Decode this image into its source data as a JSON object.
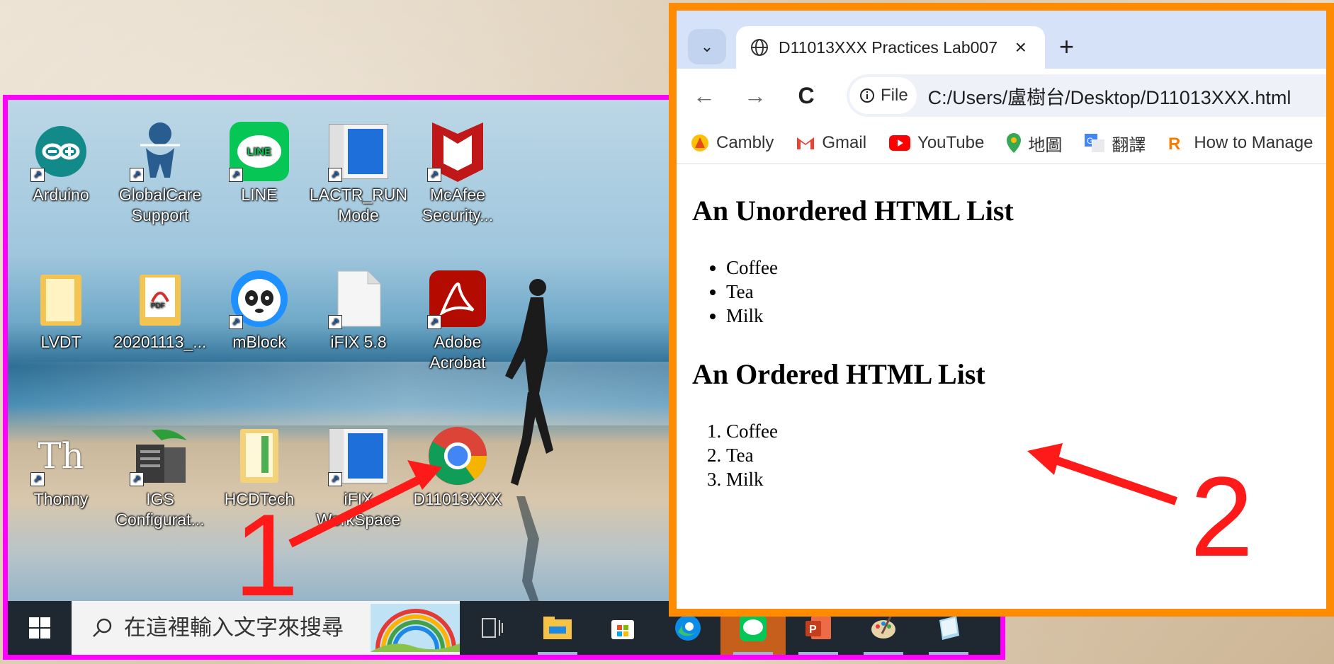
{
  "desktop": {
    "icons": [
      {
        "label_line1": "Arduino",
        "label_line2": ""
      },
      {
        "label_line1": "GlobalCare",
        "label_line2": "Support"
      },
      {
        "label_line1": "LINE",
        "label_line2": ""
      },
      {
        "label_line1": "LACTR_RUN",
        "label_line2": "Mode"
      },
      {
        "label_line1": "McAfee",
        "label_line2": "Security..."
      },
      {
        "label_line1": "LVDT",
        "label_line2": ""
      },
      {
        "label_line1": "20201113_...",
        "label_line2": ""
      },
      {
        "label_line1": "mBlock",
        "label_line2": ""
      },
      {
        "label_line1": "iFIX 5.8",
        "label_line2": ""
      },
      {
        "label_line1": "Adobe",
        "label_line2": "Acrobat"
      },
      {
        "label_line1": "Thonny",
        "label_line2": ""
      },
      {
        "label_line1": "IGS",
        "label_line2": "Configurat..."
      },
      {
        "label_line1": "HCDTech",
        "label_line2": ""
      },
      {
        "label_line1": "iFIX",
        "label_line2": "WorkSpace"
      },
      {
        "label_line1": "D11013XXX",
        "label_line2": ""
      }
    ],
    "pdf_badge": "PDF",
    "line_badge": "LINE",
    "thonny_glyph": "Th"
  },
  "taskbar": {
    "search_placeholder": "在這裡輸入文字來搜尋",
    "icons": [
      "task-view-icon",
      "file-explorer-icon",
      "microsoft-store-icon",
      "edge-icon",
      "line-icon",
      "powerpoint-icon",
      "paint-icon",
      "notepad-icon"
    ]
  },
  "browser": {
    "tab_title": "D11013XXX Practices Lab007",
    "tab_close": "×",
    "new_tab": "+",
    "nav_back": "←",
    "nav_forward": "→",
    "nav_reload": "C",
    "omnibox_chip": "File",
    "url": "C:/Users/盧樹台/Desktop/D11013XXX.html",
    "bookmarks": [
      {
        "label": "Cambly",
        "icon": "cambly-icon"
      },
      {
        "label": "Gmail",
        "icon": "gmail-icon"
      },
      {
        "label": "YouTube",
        "icon": "youtube-icon"
      },
      {
        "label": "地圖",
        "icon": "maps-icon"
      },
      {
        "label": "翻譯",
        "icon": "translate-icon"
      },
      {
        "label": "How to Manage",
        "icon": "rocket-icon"
      }
    ],
    "page": {
      "heading1": "An Unordered HTML List",
      "unordered": [
        "Coffee",
        "Tea",
        "Milk"
      ],
      "heading2": "An Ordered HTML List",
      "ordered": [
        "Coffee",
        "Tea",
        "Milk"
      ]
    }
  },
  "annotations": {
    "step1": "1",
    "step2": "2",
    "colors": {
      "desktop_frame": "#ff00ff",
      "browser_frame": "#ff8c00",
      "arrow": "#ff1a1a"
    }
  }
}
